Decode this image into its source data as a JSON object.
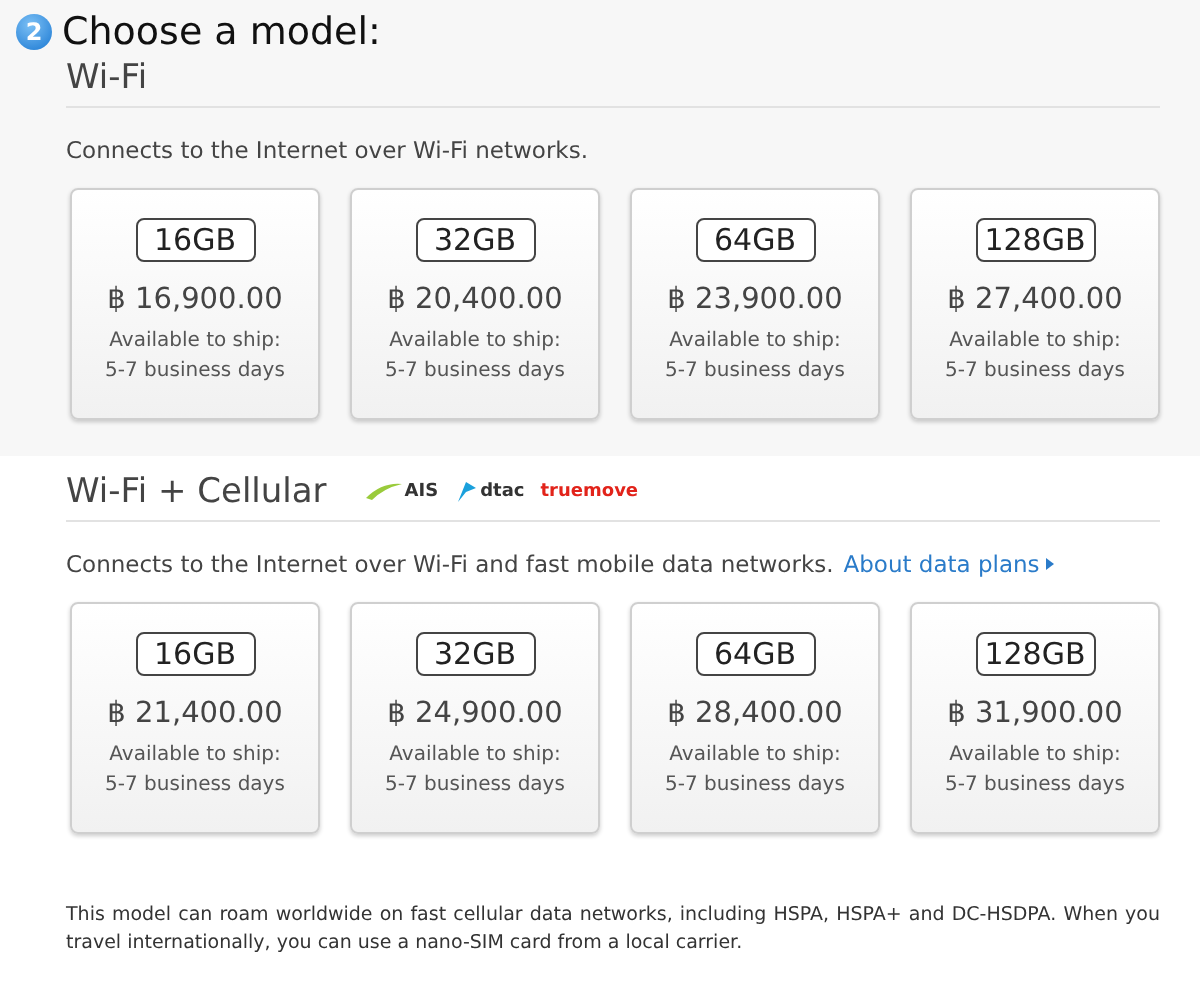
{
  "step": {
    "number": "2",
    "title": "Choose a model:"
  },
  "sections": [
    {
      "title": "Wi-Fi",
      "shaded": true,
      "description": "Connects to the Internet over Wi-Fi networks.",
      "models": [
        {
          "capacity": "16GB",
          "price": "฿ 16,900.00",
          "availability": "Available to ship:",
          "shipping": "5-7 business days"
        },
        {
          "capacity": "32GB",
          "price": "฿ 20,400.00",
          "availability": "Available to ship:",
          "shipping": "5-7 business days"
        },
        {
          "capacity": "64GB",
          "price": "฿ 23,900.00",
          "availability": "Available to ship:",
          "shipping": "5-7 business days"
        },
        {
          "capacity": "128GB",
          "price": "฿ 27,400.00",
          "availability": "Available to ship:",
          "shipping": "5-7 business days"
        }
      ]
    },
    {
      "title": "Wi-Fi + Cellular",
      "shaded": false,
      "carriers": [
        {
          "kind": "ais",
          "name": "AIS"
        },
        {
          "kind": "dtac",
          "name": "dtac"
        },
        {
          "kind": "truemove",
          "name": "truemove"
        }
      ],
      "description": "Connects to the Internet over Wi-Fi and fast mobile data networks.",
      "link": "About data plans",
      "models": [
        {
          "capacity": "16GB",
          "price": "฿ 21,400.00",
          "availability": "Available to ship:",
          "shipping": "5-7 business days"
        },
        {
          "capacity": "32GB",
          "price": "฿ 24,900.00",
          "availability": "Available to ship:",
          "shipping": "5-7 business days"
        },
        {
          "capacity": "64GB",
          "price": "฿ 28,400.00",
          "availability": "Available to ship:",
          "shipping": "5-7 business days"
        },
        {
          "capacity": "128GB",
          "price": "฿ 31,900.00",
          "availability": "Available to ship:",
          "shipping": "5-7 business days"
        }
      ]
    }
  ],
  "footnote": "This model can roam worldwide on fast cellular data networks, including HSPA, HSPA+ and DC-HSDPA. When you travel internationally, you can use a nano-SIM card from a local carrier."
}
